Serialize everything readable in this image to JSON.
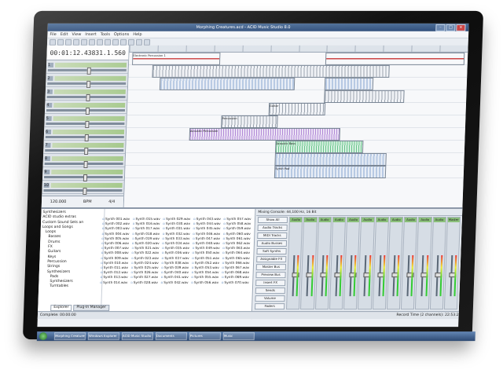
{
  "window": {
    "title": "Morphing Creatures.acd - ACID Music Studio 8.0"
  },
  "menu": [
    "File",
    "Edit",
    "View",
    "Insert",
    "Tools",
    "Options",
    "Help"
  ],
  "header": {
    "time": "00:01:12.438",
    "beats": "31.1.560"
  },
  "tracks": [
    {
      "id": "1"
    },
    {
      "id": "2"
    },
    {
      "id": "3"
    },
    {
      "id": "4"
    },
    {
      "id": "5"
    },
    {
      "id": "6"
    },
    {
      "id": "7"
    },
    {
      "id": "8"
    },
    {
      "id": "9"
    },
    {
      "id": "10"
    }
  ],
  "tempo": {
    "bpm": "120.000",
    "label": "BPM",
    "sig": "4/4"
  },
  "events": {
    "a": "Electronic Percussion 1",
    "b": "Percussion",
    "c": "Guitar",
    "d": "Percussion",
    "e": "Acoustic Percussion",
    "f": "Acoustic Bass",
    "g": "Synth Pad"
  },
  "explorer": {
    "tree": [
      "Synthesizers",
      "ACID studio extras",
      "Custom Sound Sets an",
      "Loops and Songs",
      "Loops",
      "Basses",
      "Drums",
      "FX",
      "Guitars",
      "Keys",
      "Percussion",
      "Strings",
      "Synthesizers",
      "Pads",
      "Synthesizers",
      "Turntables"
    ],
    "files": [
      [
        "Synth 001.wav",
        "Synth 002.wav",
        "Synth 003.wav",
        "Synth 004.wav",
        "Synth 005.wav",
        "Synth 006.wav",
        "Synth 007.wav",
        "Synth 008.wav",
        "Synth 009.wav",
        "Synth 010.wav",
        "Synth 011.wav",
        "Synth 012.wav",
        "Synth 013.wav",
        "Synth 014.wav"
      ],
      [
        "Synth 015.wav",
        "Synth 016.wav",
        "Synth 017.wav",
        "Synth 018.wav",
        "Synth 019.wav",
        "Synth 020.wav",
        "Synth 021.wav",
        "Synth 022.wav",
        "Synth 023.wav",
        "Synth 024.wav",
        "Synth 025.wav",
        "Synth 026.wav",
        "Synth 027.wav",
        "Synth 028.wav"
      ],
      [
        "Synth 029.wav",
        "Synth 030.wav",
        "Synth 031.wav",
        "Synth 032.wav",
        "Synth 033.wav",
        "Synth 034.wav",
        "Synth 035.wav",
        "Synth 036.wav",
        "Synth 037.wav",
        "Synth 038.wav",
        "Synth 039.wav",
        "Synth 040.wav",
        "Synth 041.wav",
        "Synth 042.wav"
      ],
      [
        "Synth 043.wav",
        "Synth 044.wav",
        "Synth 045.wav",
        "Synth 046.wav",
        "Synth 047.wav",
        "Synth 048.wav",
        "Synth 049.wav",
        "Synth 050.wav",
        "Synth 051.wav",
        "Synth 052.wav",
        "Synth 053.wav",
        "Synth 054.wav",
        "Synth 055.wav",
        "Synth 056.wav"
      ],
      [
        "Synth 057.wav",
        "Synth 058.wav",
        "Synth 059.wav",
        "Synth 060.wav",
        "Synth 061.wav",
        "Synth 062.wav",
        "Synth 063.wav",
        "Synth 064.wav",
        "Synth 065.wav",
        "Synth 066.wav",
        "Synth 067.wav",
        "Synth 068.wav",
        "Synth 069.wav",
        "Synth 070.wav"
      ]
    ],
    "tabs": [
      "Explorer",
      "Plug-In Manager"
    ]
  },
  "mixer": {
    "title": "Mixing Console: 44,100 Hz, 16 Bit",
    "buttons": [
      "Show All",
      "Audio Tracks",
      "MIDI Tracks",
      "Audio Busses",
      "Soft Synths",
      "Assignable FX",
      "Master Bus",
      "Preview Bus",
      "Insert FX",
      "Sends",
      "Volume",
      "Faders"
    ],
    "strips": [
      "Audio",
      "Audio",
      "Audio",
      "Audio",
      "Audio",
      "Audio",
      "Audio",
      "Audio",
      "Audio",
      "Audio",
      "Audio",
      "Master"
    ]
  },
  "status": {
    "left": "Complete: 00:00:00",
    "right": "Record Time (2 channels): 22:53:28"
  },
  "taskbar": [
    "Morphing Creatures.acd",
    "Windows Explorer",
    "ACID Music Studio",
    "Documents",
    "Pictures",
    "Music"
  ]
}
